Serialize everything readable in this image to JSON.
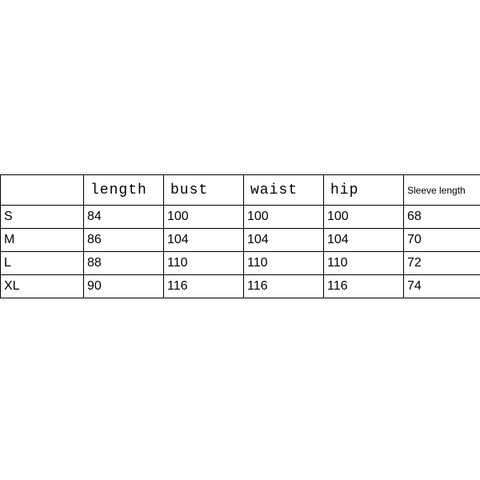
{
  "chart_data": {
    "type": "table",
    "headers": [
      "",
      "length",
      "bust",
      "waist",
      "hip",
      "Sleeve length"
    ],
    "rows": [
      {
        "size": "S",
        "length": "84",
        "bust": "100",
        "waist": "100",
        "hip": "100",
        "sleeve": "68"
      },
      {
        "size": "M",
        "length": "86",
        "bust": "104",
        "waist": "104",
        "hip": "104",
        "sleeve": "70"
      },
      {
        "size": "L",
        "length": "88",
        "bust": "110",
        "waist": "110",
        "hip": "110",
        "sleeve": "72"
      },
      {
        "size": "XL",
        "length": "90",
        "bust": "116",
        "waist": "116",
        "hip": "116",
        "sleeve": "74"
      }
    ]
  }
}
